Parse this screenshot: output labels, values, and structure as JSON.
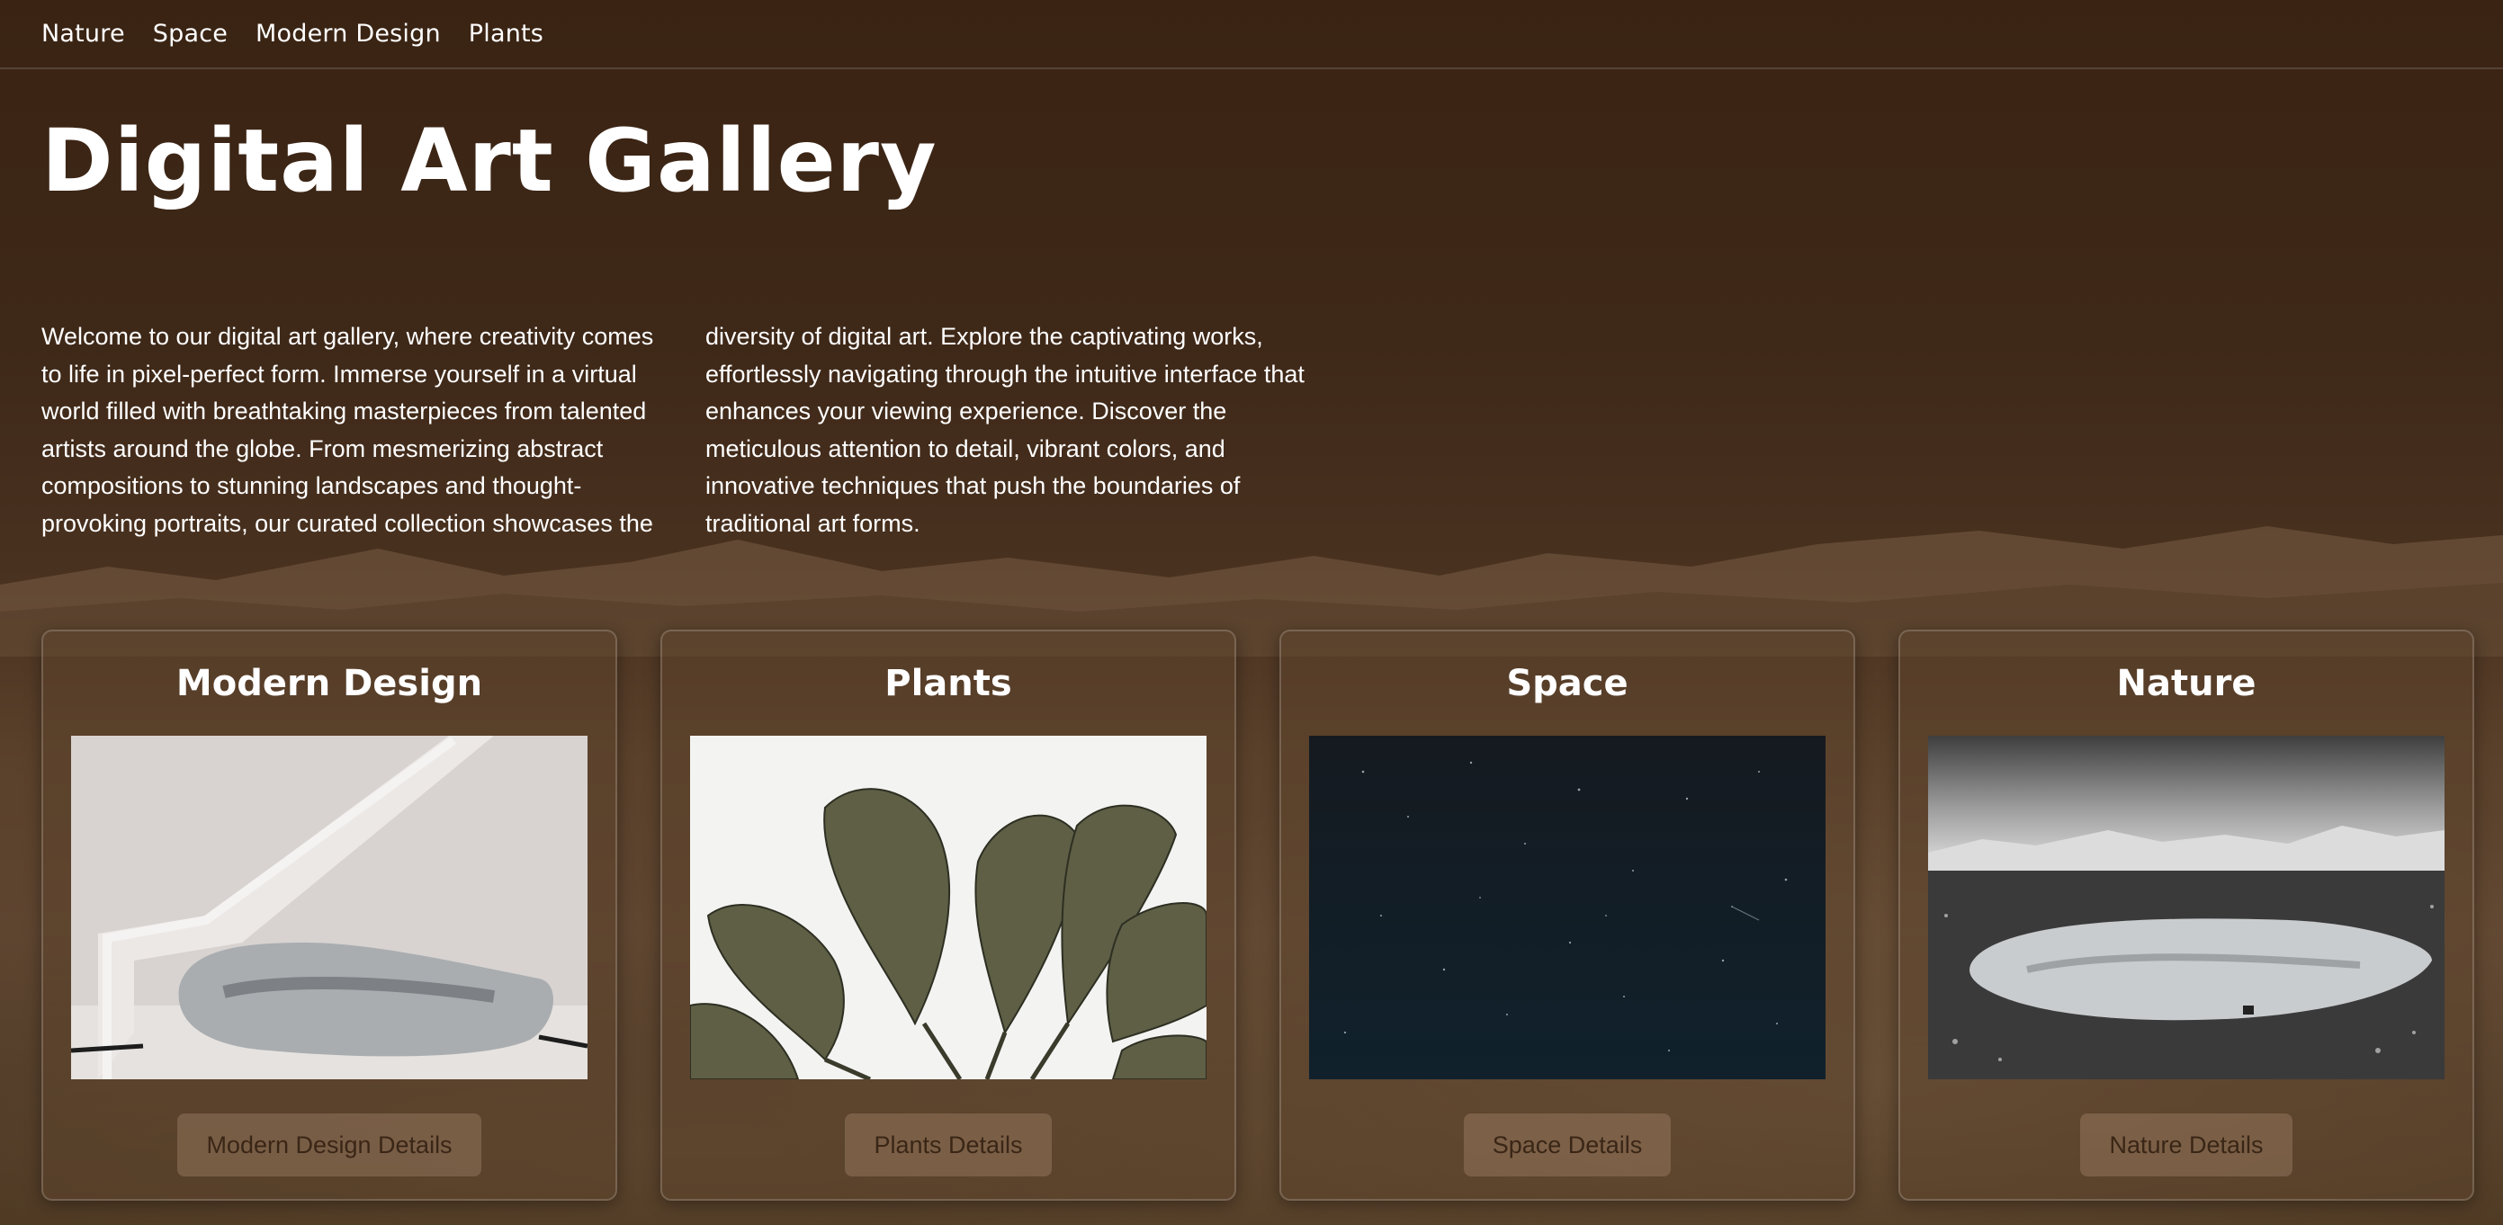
{
  "nav": {
    "links": [
      "Nature",
      "Space",
      "Modern Design",
      "Plants"
    ]
  },
  "header": {
    "title": "Digital Art Gallery"
  },
  "intro": {
    "text": "Welcome to our digital art gallery, where creativity comes to life in pixel-perfect form. Immerse yourself in a virtual world filled with breathtaking masterpieces from talented artists around the globe. From mesmerizing abstract compositions to stunning landscapes and thought-provoking portraits, our curated collection showcases the diversity of digital art. Explore the captivating works, effortlessly navigating through the intuitive interface that enhances your viewing experience. Discover the meticulous attention to detail, vibrant colors, and innovative techniques that push the boundaries of traditional art forms."
  },
  "cards": [
    {
      "title": "Modern Design",
      "button": "Modern Design Details",
      "image": "modern-design-sofa-image"
    },
    {
      "title": "Plants",
      "button": "Plants Details",
      "image": "banana-leaves-image"
    },
    {
      "title": "Space",
      "button": "Space Details",
      "image": "starry-night-sky-image"
    },
    {
      "title": "Nature",
      "button": "Nature Details",
      "image": "mountain-lake-image"
    }
  ],
  "colors": {
    "background": "#3e2818",
    "text": "#ffffff",
    "button_text": "#3a2616"
  }
}
